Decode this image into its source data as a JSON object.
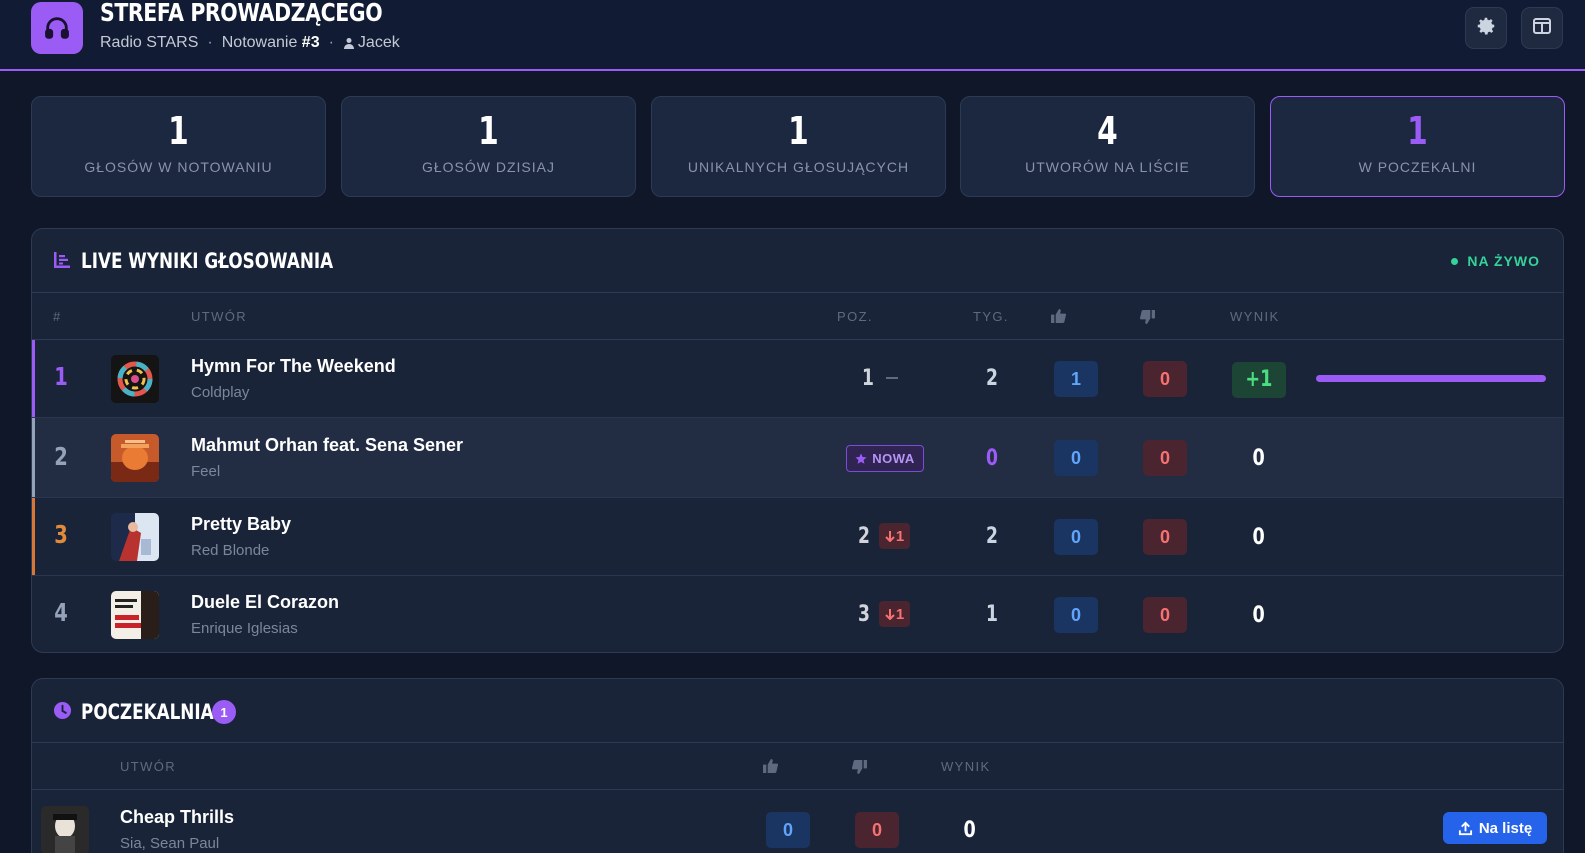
{
  "header": {
    "title": "STREFA PROWADZĄCEGO",
    "station": "Radio STARS",
    "chart_prefix": "Notowanie",
    "chart_number": "#3",
    "user": "Jacek",
    "logo_icon": "headphones-icon",
    "accent": "#9b5cf6"
  },
  "stats": [
    {
      "value": "1",
      "label": "GŁOSÓW W NOTOWANIU"
    },
    {
      "value": "1",
      "label": "GŁOSÓW DZISIAJ"
    },
    {
      "value": "1",
      "label": "UNIKALNYCH GŁOSUJĄCYCH"
    },
    {
      "value": "4",
      "label": "UTWORÓW NA LIŚCIE"
    },
    {
      "value": "1",
      "label": "W POCZEKALNI"
    }
  ],
  "results": {
    "title": "LIVE WYNIKI GŁOSOWANIA",
    "live_label": "NA ŻYWO",
    "columns": {
      "rank": "#",
      "track": "UTWÓR",
      "pos": "POZ.",
      "weeks": "TYG.",
      "score": "WYNIK"
    },
    "rows": [
      {
        "rank": "1",
        "title": "Hymn For The Weekend",
        "artist": "Coldplay",
        "prev_pos": "1",
        "change": "—",
        "weeks": "2",
        "up": "1",
        "down": "0",
        "score": "+1",
        "score_share": 1.0
      },
      {
        "rank": "2",
        "title": "Mahmut Orhan feat. Sena Sener",
        "artist": "Feel",
        "badge": "NOWA",
        "weeks": "0",
        "up": "0",
        "down": "0",
        "score": "0"
      },
      {
        "rank": "3",
        "title": "Pretty Baby",
        "artist": "Red Blonde",
        "prev_pos": "2",
        "change": "1",
        "weeks": "2",
        "up": "0",
        "down": "0",
        "score": "0"
      },
      {
        "rank": "4",
        "title": "Duele El Corazon",
        "artist": "Enrique Iglesias",
        "prev_pos": "3",
        "change": "1",
        "weeks": "1",
        "up": "0",
        "down": "0",
        "score": "0"
      }
    ]
  },
  "waiting": {
    "title": "POCZEKALNIA",
    "count": "1",
    "columns": {
      "track": "UTWÓR",
      "score": "WYNIK"
    },
    "rows": [
      {
        "title": "Cheap Thrills",
        "artist": "Sia, Sean Paul",
        "up": "0",
        "down": "0",
        "score": "0",
        "action": "Na listę"
      }
    ]
  }
}
